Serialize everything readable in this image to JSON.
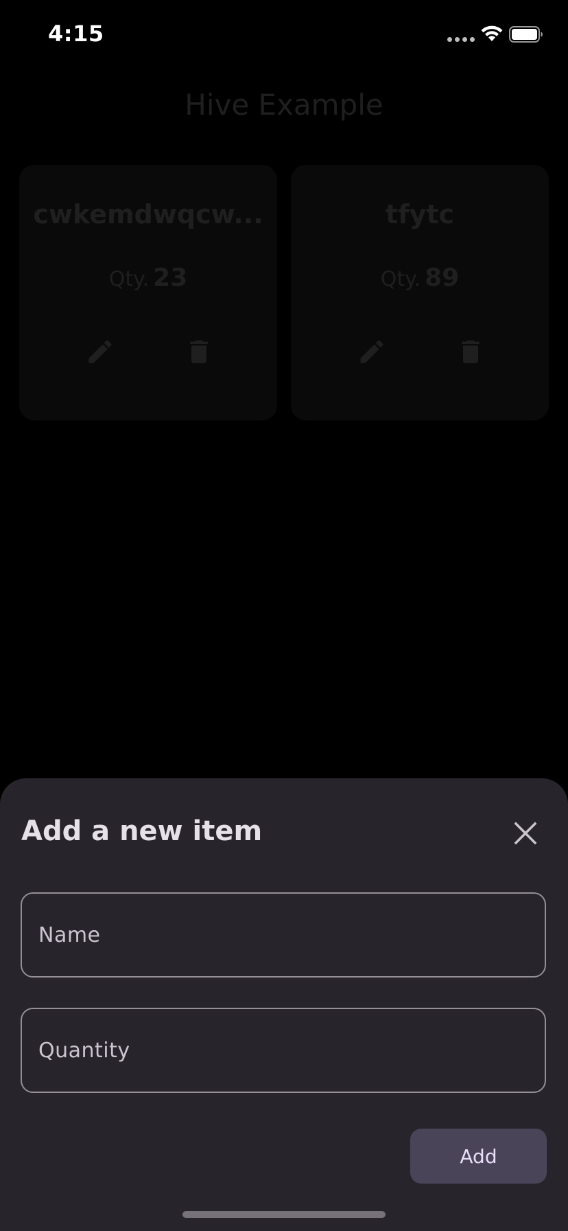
{
  "status_bar": {
    "time": "4:15",
    "icons": [
      "signal-dots-icon",
      "wifi-icon",
      "battery-icon"
    ]
  },
  "app": {
    "title": "Hive Example",
    "items": [
      {
        "name": "cwkemdwqcw...",
        "qty_label": "Qty.",
        "qty_value": "23"
      },
      {
        "name": "tfytc",
        "qty_label": "Qty.",
        "qty_value": "89"
      }
    ]
  },
  "sheet": {
    "title": "Add a new item",
    "name_field": {
      "placeholder": "Name",
      "value": ""
    },
    "quantity_field": {
      "placeholder": "Quantity",
      "value": ""
    },
    "add_label": "Add"
  },
  "colors": {
    "sheet_background": "#27242c",
    "button_background": "#4a4459",
    "button_text": "#e8def8",
    "field_border": "#948f99",
    "dimmed_text": "#1f1f1f"
  }
}
